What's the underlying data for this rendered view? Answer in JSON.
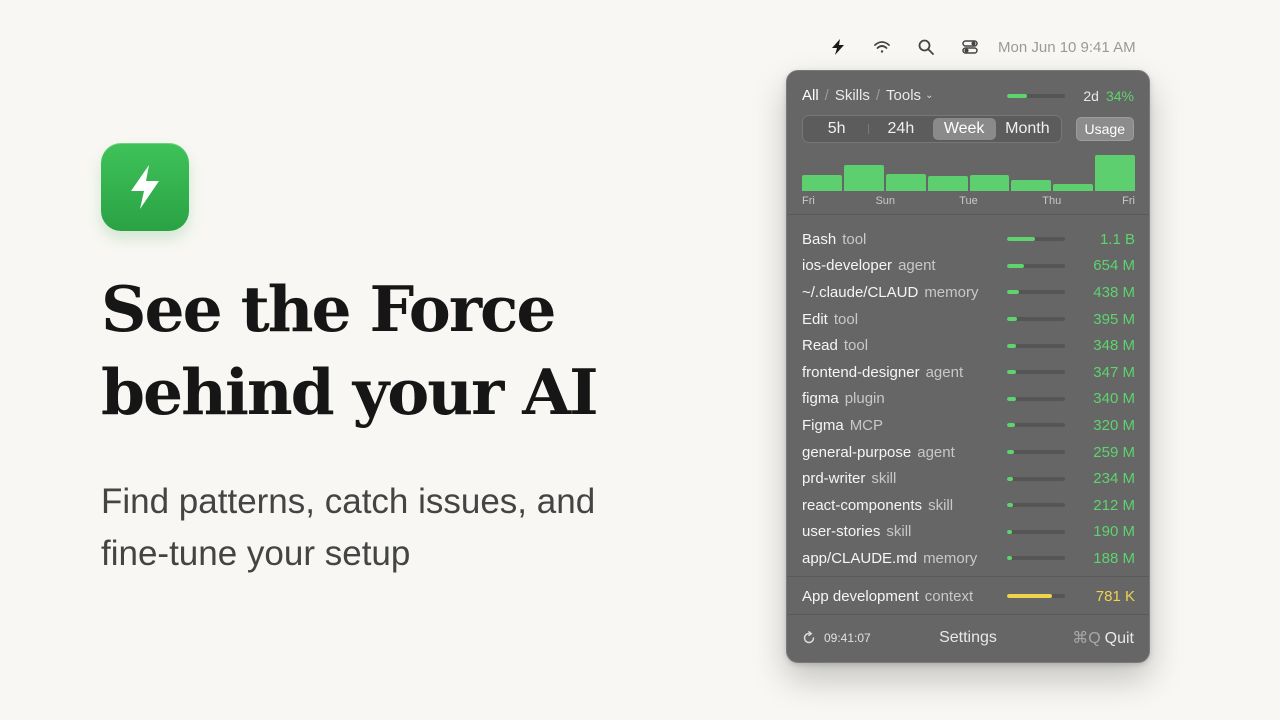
{
  "hero": {
    "headline_line1": "See the Force",
    "headline_line2": "behind your AI",
    "subline_line1": "Find patterns, catch issues, and",
    "subline_line2": "fine-tune your setup"
  },
  "menubar": {
    "icons": [
      "bolt-icon",
      "wifi-icon",
      "search-icon",
      "control-center-icon"
    ],
    "clock": "Mon Jun 10  9:41 AM"
  },
  "panel": {
    "breadcrumbs": [
      "All",
      "Skills",
      "Tools"
    ],
    "overall": {
      "period": "2d",
      "percent": "34%",
      "fraction": 0.34
    },
    "ranges": [
      "5h",
      "24h",
      "Week",
      "Month"
    ],
    "selected_range": "Week",
    "usage_button": "Usage",
    "chart_days": [
      "Fri",
      "Sun",
      "Tue",
      "Thu",
      "Fri"
    ],
    "daily_usage": [
      0.42,
      0.68,
      0.44,
      0.4,
      0.42,
      0.28,
      0.18,
      0.95
    ],
    "rows": [
      {
        "name": "Bash",
        "type": "tool",
        "value": "1.1 B",
        "fraction": 0.48
      },
      {
        "name": "ios-developer",
        "type": "agent",
        "value": "654 M",
        "fraction": 0.3
      },
      {
        "name": "~/.claude/CLAUD",
        "type": "memory",
        "value": "438 M",
        "fraction": 0.2
      },
      {
        "name": "Edit",
        "type": "tool",
        "value": "395 M",
        "fraction": 0.18
      },
      {
        "name": "Read",
        "type": "tool",
        "value": "348 M",
        "fraction": 0.16
      },
      {
        "name": "frontend-designer",
        "type": "agent",
        "value": "347 M",
        "fraction": 0.16
      },
      {
        "name": "figma",
        "type": "plugin",
        "value": "340 M",
        "fraction": 0.15
      },
      {
        "name": "Figma",
        "type": "MCP",
        "value": "320 M",
        "fraction": 0.14
      },
      {
        "name": "general-purpose",
        "type": "agent",
        "value": "259 M",
        "fraction": 0.12
      },
      {
        "name": "prd-writer",
        "type": "skill",
        "value": "234 M",
        "fraction": 0.1
      },
      {
        "name": "react-components",
        "type": "skill",
        "value": "212 M",
        "fraction": 0.1
      },
      {
        "name": "user-stories",
        "type": "skill",
        "value": "190 M",
        "fraction": 0.08
      },
      {
        "name": "app/CLAUDE.md",
        "type": "memory",
        "value": "188 M",
        "fraction": 0.08
      }
    ],
    "context_row": {
      "name": "App development",
      "type": "context",
      "value": "781 K",
      "fraction": 0.78
    },
    "footer": {
      "time": "09:41:07",
      "settings": "Settings",
      "quit_shortcut": "⌘Q",
      "quit": "Quit"
    },
    "colors": {
      "accent_green": "#5ed36e",
      "accent_yellow": "#efd44c",
      "panel_bg": "#666666"
    }
  }
}
